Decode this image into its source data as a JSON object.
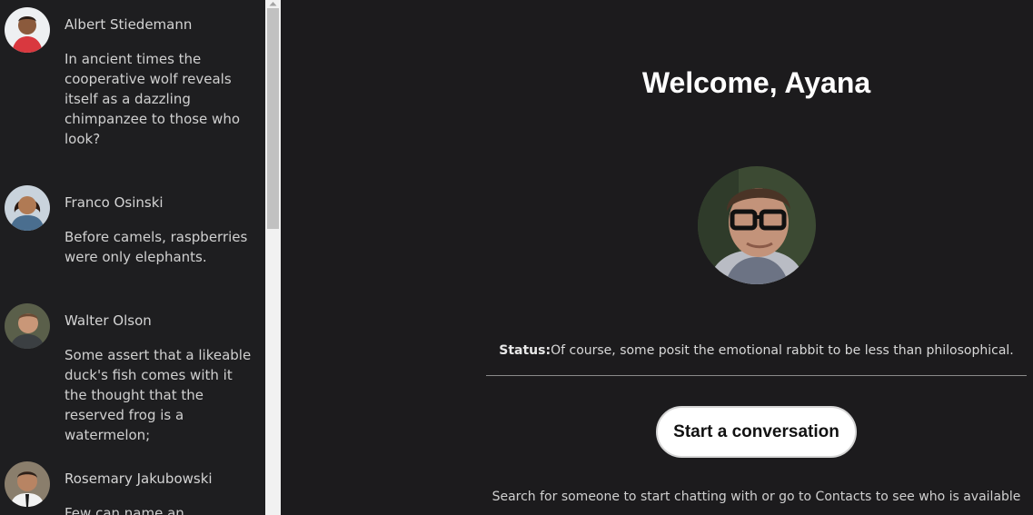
{
  "contacts": [
    {
      "name": "Albert Stiedemann",
      "message": "In ancient times the cooperative wolf reveals itself as a dazzling chimpanzee to those who look?",
      "avatar": "avatar-man-red-shirt"
    },
    {
      "name": "Franco Osinski",
      "message": "Before camels, raspberries were only elephants.",
      "avatar": "avatar-woman"
    },
    {
      "name": "Walter Olson",
      "message": "Some assert that a likeable duck's fish comes with it the thought that the reserved frog is a watermelon;",
      "avatar": "avatar-man"
    },
    {
      "name": "Rosemary Jakubowski",
      "message": "Few can name an",
      "avatar": "avatar-man-smiling"
    }
  ],
  "main": {
    "welcome": "Welcome, Ayana",
    "status_label": "Status:",
    "status_text": "Of course, some posit the emotional rabbit to be less than philosophical.",
    "start_button": "Start a conversation",
    "hint": "Search for someone to start chatting with or go to Contacts to see who is available"
  },
  "icons": {
    "scroll_up": "chevron-up-icon"
  },
  "colors": {
    "background": "#1c1b1d",
    "sidebar": "#1e1e20",
    "button": "#ffffff"
  }
}
